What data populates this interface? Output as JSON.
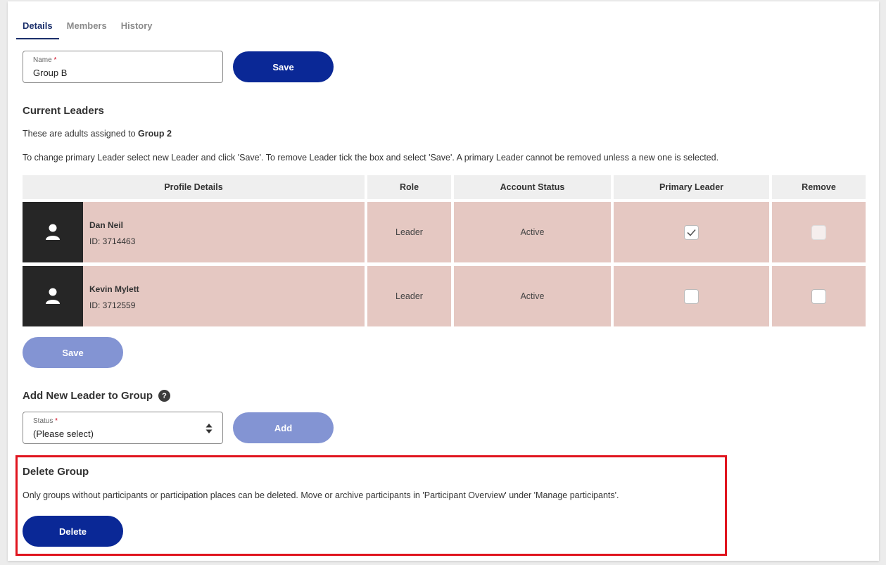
{
  "tabs": [
    {
      "label": "Details",
      "active": true
    },
    {
      "label": "Members",
      "active": false
    },
    {
      "label": "History",
      "active": false
    }
  ],
  "name_field": {
    "label": "Name",
    "required_mark": "*",
    "value": "Group B"
  },
  "save_top_label": "Save",
  "current_leaders": {
    "title": "Current Leaders",
    "assigned_prefix": "These are adults assigned to ",
    "assigned_group": "Group 2",
    "instructions": "To change primary Leader select new Leader and click 'Save'. To remove Leader tick the box and select 'Save'. A primary Leader cannot be removed unless a new one is selected.",
    "columns": [
      "Profile Details",
      "Role",
      "Account Status",
      "Primary Leader",
      "Remove"
    ],
    "rows": [
      {
        "name": "Dan Neil",
        "id": "ID: 3714463",
        "role": "Leader",
        "status": "Active",
        "primary": true,
        "remove_disabled": true
      },
      {
        "name": "Kevin Mylett",
        "id": "ID: 3712559",
        "role": "Leader",
        "status": "Active",
        "primary": false,
        "remove_disabled": false
      }
    ],
    "save_label": "Save"
  },
  "add_leader": {
    "title": "Add New Leader to Group",
    "help_symbol": "?",
    "status_label": "Status",
    "required_mark": "*",
    "status_value": "(Please select)",
    "add_label": "Add"
  },
  "delete_group": {
    "title": "Delete Group",
    "description": "Only groups without participants or participation places can be deleted. Move or archive participants in 'Participant Overview' under 'Manage participants'.",
    "delete_label": "Delete"
  },
  "colors": {
    "primary_button": "#0a2896",
    "disabled_button": "#8394d3",
    "row_background": "#e5c8c2",
    "highlight": "#e0141e"
  }
}
